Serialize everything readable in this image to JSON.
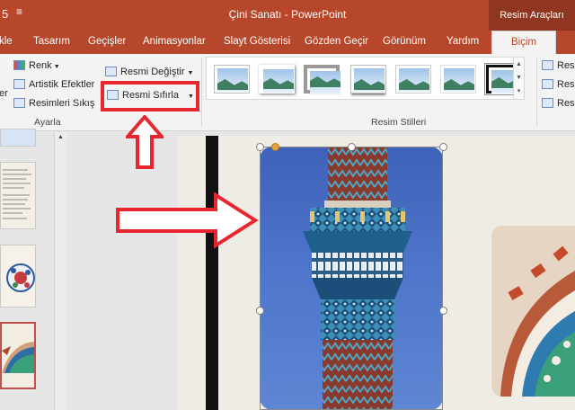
{
  "titlebar": {
    "document": "Çini Sanatı",
    "separator": "-",
    "app": "PowerPoint",
    "context_tab": "Resim Araçları",
    "qat_icon": "dropdown-icon",
    "qat_partial": "5"
  },
  "tabs": [
    "kle",
    "Tasarım",
    "Geçişler",
    "Animasyonlar",
    "Slayt Gösterisi",
    "Gözden Geçir",
    "Görünüm",
    "Yardım",
    "Biçim"
  ],
  "ribbon": {
    "adjust": {
      "partial_left": "er",
      "color": "Renk",
      "artistic": "Artistik Efektler",
      "compress": "Resimleri Sıkış",
      "change": "Resmi Değiştir",
      "reset": "Resmi Sıfırla",
      "group_label": "Ayarla"
    },
    "styles": {
      "group_label": "Resim Stilleri",
      "gallery_count": 7
    },
    "right_items": [
      "Resi",
      "Resi",
      "Resi"
    ]
  },
  "colors": {
    "accent": "#b7472a",
    "context": "#8f3520",
    "highlight": "#e8262f",
    "ribbon_bg": "#f3f3f3"
  }
}
